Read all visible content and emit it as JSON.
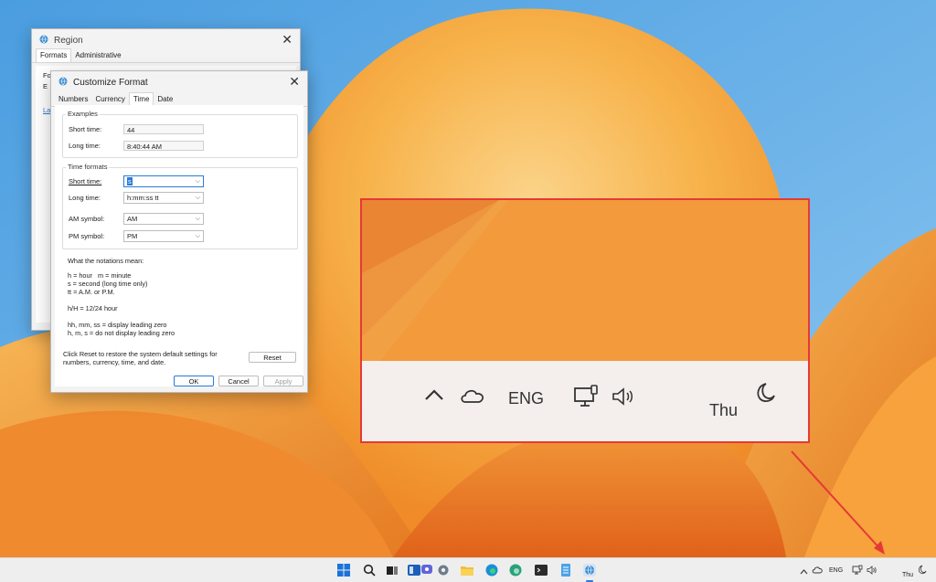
{
  "region_window": {
    "title": "Region",
    "tabs": [
      "Formats",
      "Administrative"
    ],
    "partial_labels": [
      "Fo",
      "E",
      "La"
    ]
  },
  "customize_format": {
    "title": "Customize Format",
    "tabs": [
      "Numbers",
      "Currency",
      "Time",
      "Date"
    ],
    "active_tab": "Time",
    "examples": {
      "group_label": "Examples",
      "short_time_label": "Short time:",
      "short_time_value": "44",
      "long_time_label": "Long time:",
      "long_time_value": "8:40:44 AM"
    },
    "time_formats": {
      "group_label": "Time formats",
      "short_time_label": "Short time:",
      "short_time_value": "s",
      "long_time_label": "Long time:",
      "long_time_value": "h:mm:ss tt",
      "am_label": "AM symbol:",
      "am_value": "AM",
      "pm_label": "PM symbol:",
      "pm_value": "PM"
    },
    "notations_title": "What the notations mean:",
    "notations": [
      "h = hour   m = minute",
      "s = second (long time only)",
      "tt = A.M. or P.M.",
      "",
      "h/H = 12/24 hour",
      "",
      "hh, mm, ss = display leading zero",
      "h, m, s = do not display leading zero"
    ],
    "reset_text": "Click Reset to restore the system default settings for numbers, currency, time, and date.",
    "reset_label": "Reset",
    "ok_label": "OK",
    "cancel_label": "Cancel",
    "apply_label": "Apply"
  },
  "zoom_inset": {
    "lang": "ENG",
    "day": "Thu"
  },
  "taskbar": {
    "lang": "ENG",
    "day": "Thu",
    "apps": [
      "start",
      "search",
      "task-view",
      "widgets",
      "chat",
      "settings",
      "file-explorer",
      "edge",
      "edge-beta",
      "terminal",
      "notepad",
      "control-panel"
    ]
  },
  "colors": {
    "annotation": "#e53935",
    "accent": "#2a7ad8"
  }
}
